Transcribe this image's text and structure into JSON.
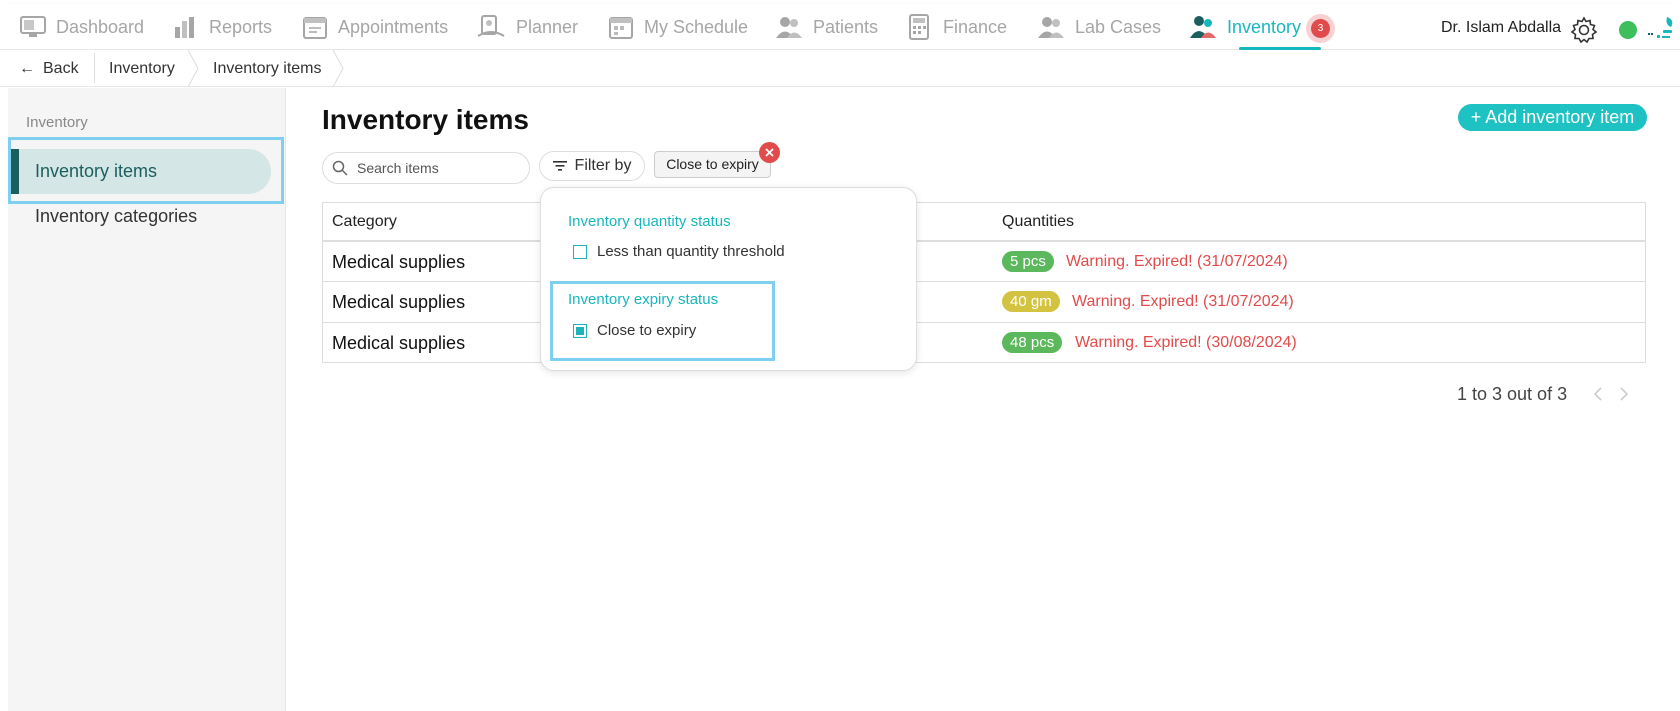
{
  "nav": {
    "items": [
      {
        "label": "Dashboard",
        "icon": "monitor-icon"
      },
      {
        "label": "Reports",
        "icon": "bar-chart-icon"
      },
      {
        "label": "Appointments",
        "icon": "calendar-icon"
      },
      {
        "label": "Planner",
        "icon": "planner-icon"
      },
      {
        "label": "My Schedule",
        "icon": "schedule-icon"
      },
      {
        "label": "Patients",
        "icon": "users-icon"
      },
      {
        "label": "Finance",
        "icon": "calculator-icon"
      },
      {
        "label": "Lab Cases",
        "icon": "lab-icon"
      },
      {
        "label": "Inventory",
        "icon": "inventory-icon"
      }
    ],
    "active": "Inventory",
    "badge_count": "3",
    "user_name": "Dr. Islam Abdalla",
    "accent_color": "#17b7bd",
    "status_color": "#3fbf5b"
  },
  "breadcrumb": {
    "back_label": "Back",
    "items": [
      "Inventory",
      "Inventory items"
    ]
  },
  "sidebar": {
    "heading": "Inventory",
    "items": [
      {
        "label": "Inventory items",
        "active": true
      },
      {
        "label": "Inventory categories",
        "active": false
      }
    ]
  },
  "main": {
    "title": "Inventory items",
    "add_button": "+ Add inventory item",
    "search_placeholder": "Search items",
    "filter_label": "Filter by",
    "active_chip": "Close to expiry"
  },
  "filter_menu": {
    "quantity_heading": "Inventory quantity status",
    "quantity_option": {
      "label": "Less than quantity threshold",
      "checked": false
    },
    "expiry_heading": "Inventory expiry status",
    "expiry_option": {
      "label": "Close to expiry",
      "checked": true
    }
  },
  "table": {
    "columns": [
      "Category",
      "Quantities"
    ],
    "rows": [
      {
        "category": "Medical supplies",
        "qty": "5 pcs",
        "qty_color": "#5cb85c",
        "warning": "Warning. Expired! (31/07/2024)"
      },
      {
        "category": "Medical supplies",
        "qty": "40 gm",
        "qty_color": "#d4c341",
        "warning": "Warning. Expired! (31/07/2024)"
      },
      {
        "category": "Medical supplies",
        "qty": "48 pcs",
        "qty_color": "#5cb85c",
        "warning": "Warning. Expired! (30/08/2024)"
      }
    ]
  },
  "pagination": {
    "summary": "1 to 3 out of 3"
  }
}
